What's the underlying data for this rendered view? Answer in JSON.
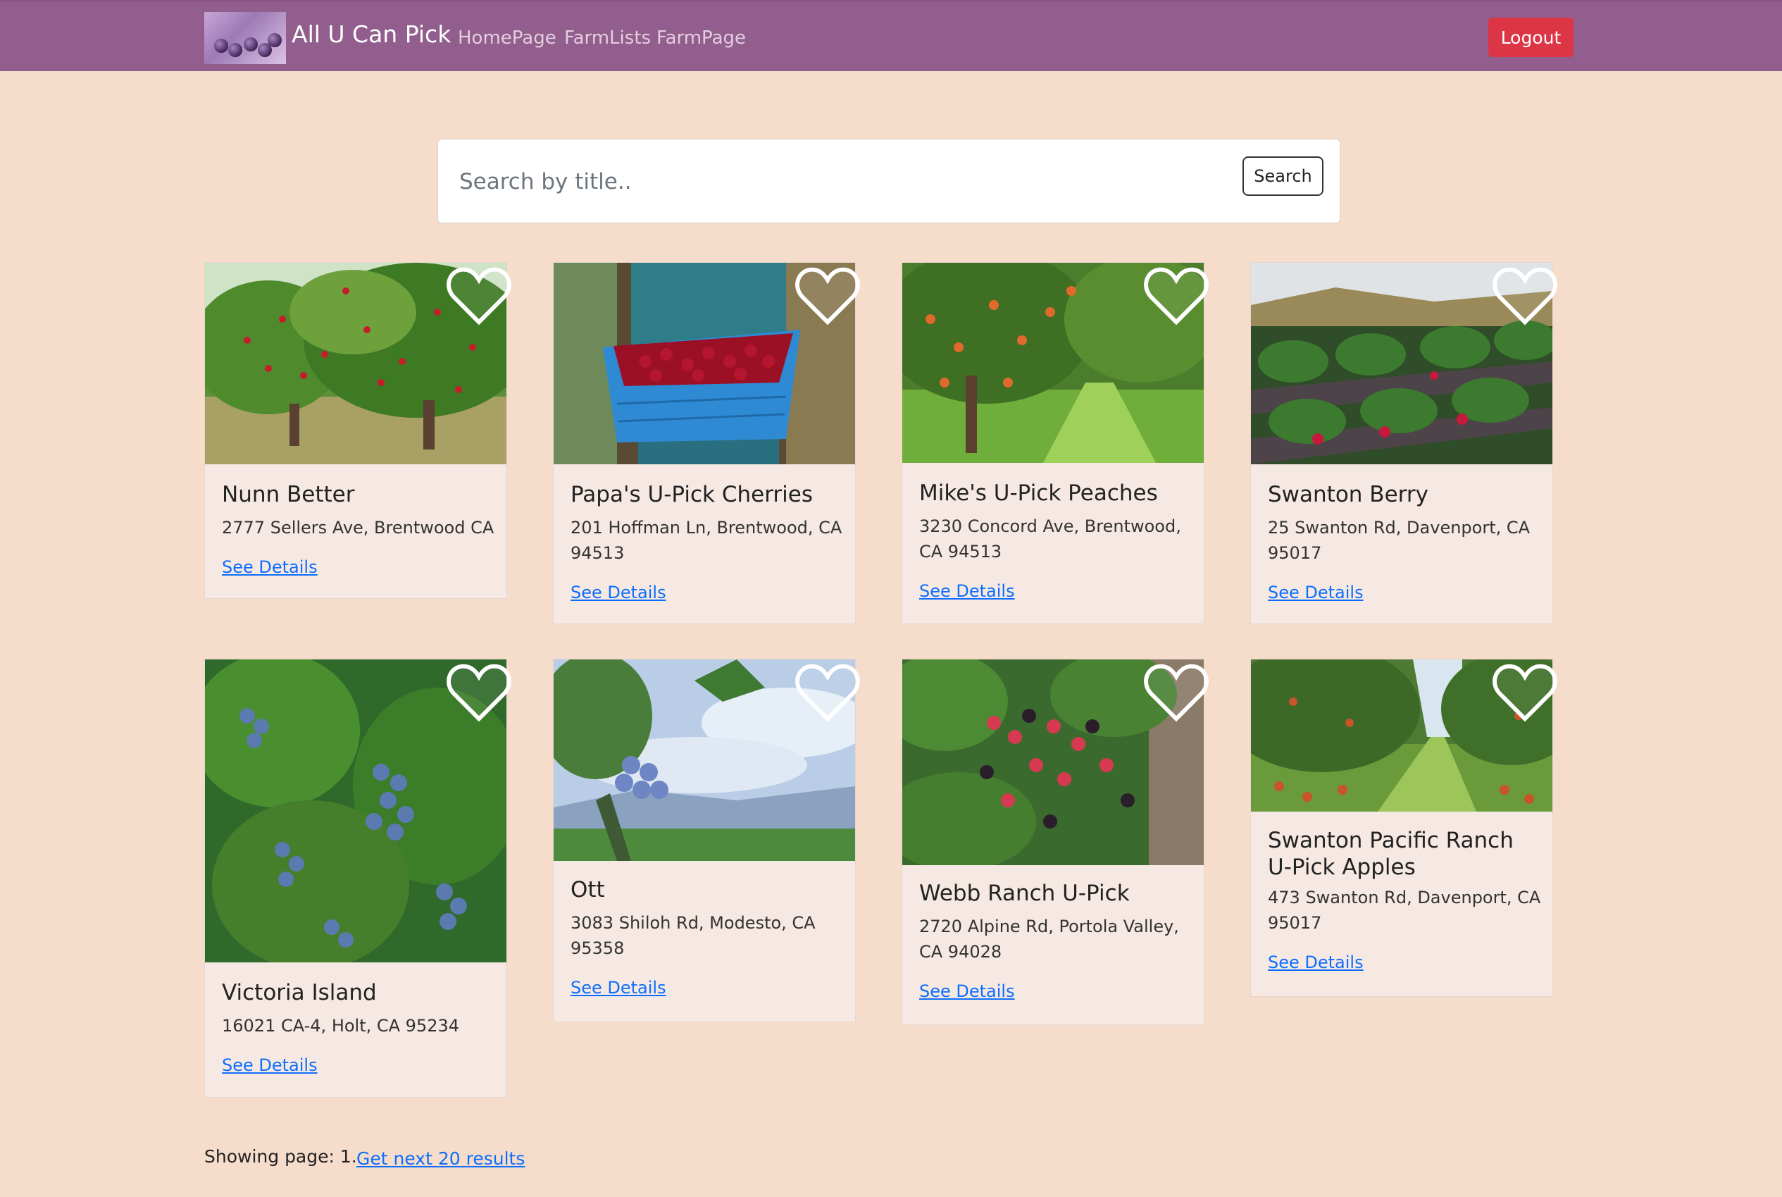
{
  "header": {
    "brand": "All U Can Pick",
    "nav": [
      "HomePage",
      "FarmLists",
      "FarmPage"
    ],
    "logout_label": "Logout"
  },
  "search": {
    "placeholder": "Search by title..",
    "button_label": "Search"
  },
  "farms": [
    {
      "name": "Nunn Better",
      "address": "2777 Sellers Ave, Brentwood CA",
      "link": "See Details",
      "image": "cherry orchard"
    },
    {
      "name": "Papa's U-Pick Cherries",
      "address": "201 Hoffman Ln, Brentwood, CA 94513",
      "link": "See Details",
      "image": "basket of cherries"
    },
    {
      "name": "Mike's U-Pick Peaches",
      "address": "3230 Concord Ave, Brentwood, CA 94513",
      "link": "See Details",
      "image": "peach orchard"
    },
    {
      "name": "Swanton Berry",
      "address": "25 Swanton Rd, Davenport, CA 95017",
      "link": "See Details",
      "image": "strawberry field"
    },
    {
      "name": "Victoria Island",
      "address": "16021 CA-4, Holt, CA 95234",
      "link": "See Details",
      "image": "blueberry bushes"
    },
    {
      "name": "Ott",
      "address": "3083 Shiloh Rd, Modesto, CA 95358",
      "link": "See Details",
      "image": "blueberry and sky"
    },
    {
      "name": "Webb Ranch U-Pick",
      "address": "2720 Alpine Rd, Portola Valley, CA 94028",
      "link": "See Details",
      "image": "blackberries"
    },
    {
      "name": "Swanton Pacific Ranch U-Pick Apples",
      "address": "473 Swanton Rd, Davenport, CA 95017",
      "link": "See Details",
      "image": "apple orchard"
    }
  ],
  "footer": {
    "page_text": "Showing page: 1.",
    "next_link": "Get next 20 results"
  },
  "colors": {
    "navbar": "#925e8d",
    "page_background": "#f5dccb",
    "card_background": "#f6e9e3",
    "logout": "#dc3545",
    "link": "#0d6efd"
  }
}
